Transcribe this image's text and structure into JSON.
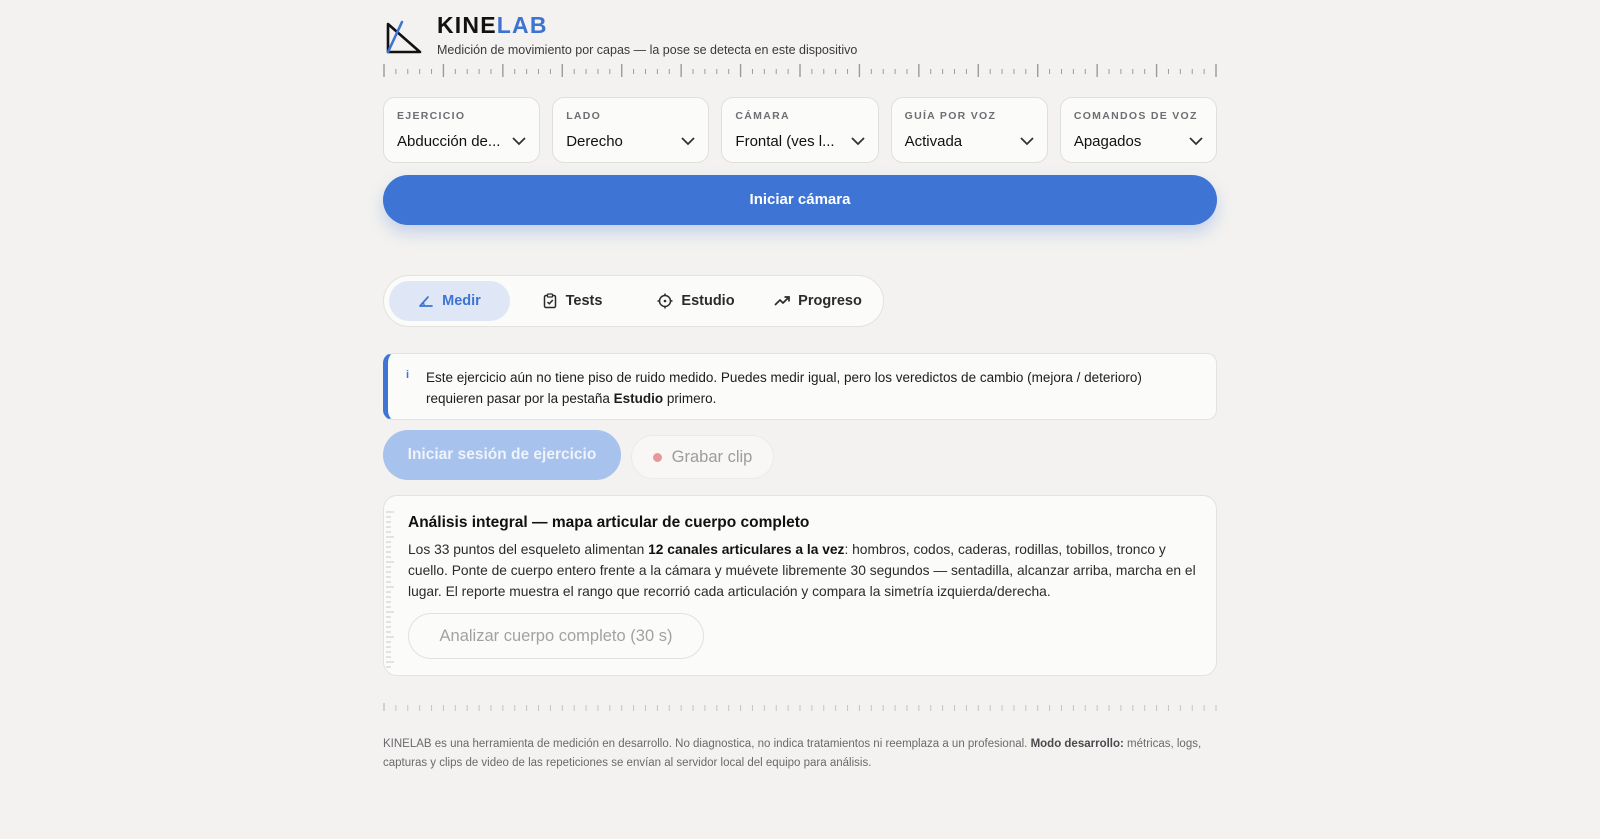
{
  "brand": {
    "name_part1": "KINE",
    "name_part2": "LAB",
    "tagline": "Medición de movimiento por capas — la pose se detecta en este dispositivo",
    "logo_icon": "angle-icon",
    "accent_color": "#3e74d3"
  },
  "selects": [
    {
      "label": "EJERCICIO",
      "value": "Abducción de..."
    },
    {
      "label": "LADO",
      "value": "Derecho"
    },
    {
      "label": "CÁMARA",
      "value": "Frontal (ves l..."
    },
    {
      "label": "GUÍA POR VOZ",
      "value": "Activada"
    },
    {
      "label": "COMANDOS DE VOZ",
      "value": "Apagados"
    }
  ],
  "camera_button": "Iniciar cámara",
  "tabs": [
    {
      "label": "Medir",
      "icon": "angle-icon",
      "active": true
    },
    {
      "label": "Tests",
      "icon": "clipboard-check-icon",
      "active": false
    },
    {
      "label": "Estudio",
      "icon": "crosshair-icon",
      "active": false
    },
    {
      "label": "Progreso",
      "icon": "trending-up-icon",
      "active": false
    }
  ],
  "info": {
    "icon": "i",
    "text_before": "Este ejercicio aún no tiene piso de ruido medido. Puedes medir igual, pero los veredictos de cambio (mejora / deterioro) requieren pasar por la pestaña ",
    "text_bold": "Estudio",
    "text_after": " primero."
  },
  "session_button": "Iniciar sesión de ejercicio",
  "clip_button": "Grabar clip",
  "analysis": {
    "title": "Análisis integral — mapa articular de cuerpo completo",
    "body_before": "Los 33 puntos del esqueleto alimentan ",
    "body_bold": "12 canales articulares a la vez",
    "body_after": ": hombros, codos, caderas, rodillas, tobillos, tronco y cuello. Ponte de cuerpo entero frente a la cámara y muévete libremente 30 segundos — sentadilla, alcanzar arriba, marcha en el lugar. El reporte muestra el rango que recorrió cada articulación y compara la simetría izquierda/derecha.",
    "button": "Analizar cuerpo completo (30 s)"
  },
  "footer": {
    "text_before": "KINELAB es una herramienta de medición en desarrollo. No diagnostica, no indica tratamientos ni reemplaza a un profesional. ",
    "text_bold": "Modo desarrollo:",
    "text_after": " métricas, logs, capturas y clips de video de las repeticiones se envían al servidor local del equipo para análisis."
  }
}
